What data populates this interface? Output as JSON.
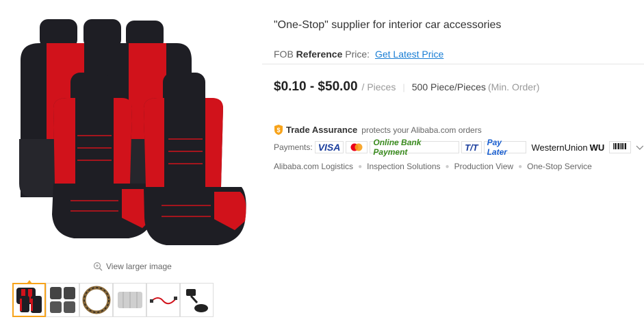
{
  "gallery": {
    "main_image_icon": "car-seat-cover-photo",
    "view_larger_label": "View larger image",
    "thumbnails": [
      {
        "icon": "red-seat-cover-thumbnail",
        "active": true
      },
      {
        "icon": "floor-mats-thumbnail",
        "active": false
      },
      {
        "icon": "steering-wheel-cover-thumbnail",
        "active": false
      },
      {
        "icon": "sunshade-thumbnail",
        "active": false
      },
      {
        "icon": "red-cable-thumbnail",
        "active": false
      },
      {
        "icon": "phone-holder-thumbnail",
        "active": false
      }
    ]
  },
  "product": {
    "title": "\"One-Stop\" supplier for interior car accessories",
    "fob_prefix": "FOB",
    "fob_reference": "Reference",
    "fob_suffix": "Price:",
    "latest_price_link": "Get Latest Price"
  },
  "pricing": {
    "price_range": "$0.10 - $50.00",
    "unit": "/ Pieces",
    "separator": "|",
    "moq": "500 Piece/Pieces",
    "moq_note": "(Min. Order)"
  },
  "trade_assurance": {
    "title": "Trade Assurance",
    "text": "protects your Alibaba.com orders"
  },
  "payments": {
    "label": "Payments:",
    "methods": {
      "visa": "VISA",
      "mastercard": "mastercard-logo",
      "online_bank": "Online Bank Payment",
      "tt": "T/T",
      "pay_later": "Pay Later",
      "western_union": "WesternUnion",
      "western_union_mark": "WU",
      "boleto": "Boleto"
    },
    "expand_icon": "chevron-down-icon"
  },
  "services": [
    "Alibaba.com Logistics",
    "Inspection Solutions",
    "Production View",
    "One-Stop Service"
  ],
  "colors": {
    "accent_orange": "#f7a31a",
    "link_blue": "#1a7ed4",
    "seat_red": "#d1121b",
    "seat_black": "#1e1e24"
  }
}
